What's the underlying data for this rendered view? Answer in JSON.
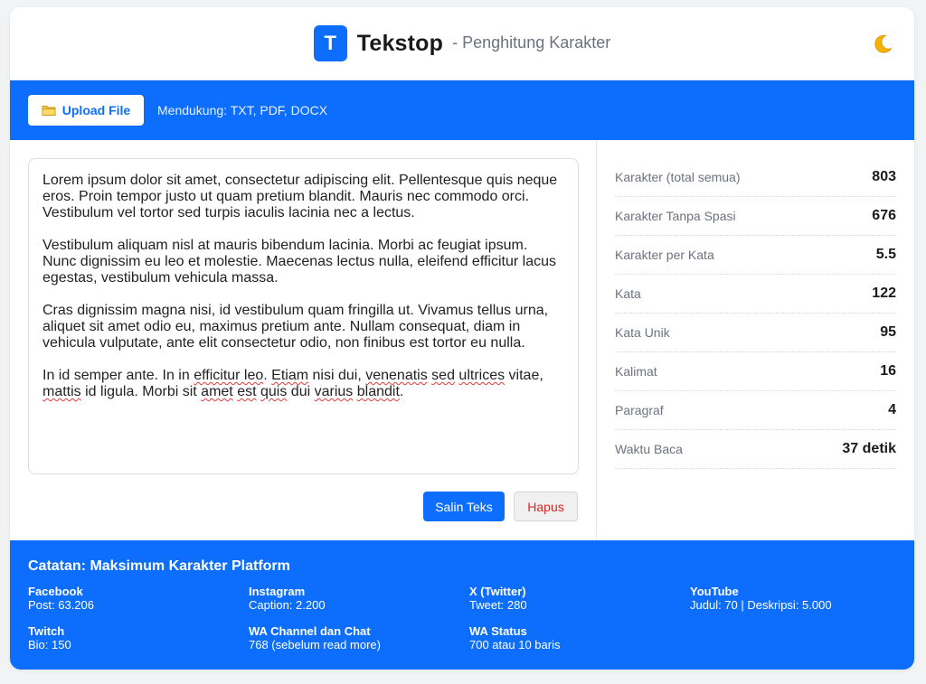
{
  "header": {
    "logo_letter": "T",
    "app_name": "Tekstop",
    "subtitle": "- Penghitung Karakter",
    "theme_icon": "moon-icon"
  },
  "toolbar": {
    "upload_label": "Upload File",
    "upload_icon": "folder-icon",
    "supported": "Mendukung: TXT, PDF, DOCX"
  },
  "editor": {
    "paragraphs": [
      "Lorem ipsum dolor sit amet, consectetur adipiscing elit. Pellentesque quis neque eros. Proin tempor justo ut quam pretium blandit. Mauris nec commodo orci. Vestibulum vel tortor sed turpis iaculis lacinia nec a lectus.",
      "Vestibulum aliquam nisl at mauris bibendum lacinia. Morbi ac feugiat ipsum. Nunc dignissim eu leo et molestie. Maecenas lectus nulla, eleifend efficitur lacus egestas, vestibulum vehicula massa.",
      "Cras dignissim magna nisi, id vestibulum quam fringilla ut. Vivamus tellus urna, aliquet sit amet odio eu, maximus pretium ante. Nullam consequat, diam in vehicula vulputate, ante elit consectetur odio, non finibus est tortor eu nulla."
    ],
    "last_paragraph": {
      "s1": "In id semper ante. In in ",
      "s2": "efficitur leo",
      "s3": ". ",
      "s4": "Etiam",
      "s5": " nisi dui, ",
      "s6": "venenatis",
      "s7": " ",
      "s8": "sed",
      "s9": " ",
      "s10": "ultrices",
      "s11": " vitae, ",
      "s12": "mattis",
      "s13": " id ligula. Morbi sit ",
      "s14": "amet",
      "s15": " ",
      "s16": "est",
      "s17": " ",
      "s18": "quis",
      "s19": " dui ",
      "s20": "varius",
      "s21": " ",
      "s22": "blandit",
      "s23": "."
    },
    "copy_label": "Salin Teks",
    "clear_label": "Hapus"
  },
  "stats": [
    {
      "label": "Karakter (total semua)",
      "value": "803"
    },
    {
      "label": "Karakter Tanpa Spasi",
      "value": "676"
    },
    {
      "label": "Karakter per Kata",
      "value": "5.5"
    },
    {
      "label": "Kata",
      "value": "122"
    },
    {
      "label": "Kata Unik",
      "value": "95"
    },
    {
      "label": "Kalimat",
      "value": "16"
    },
    {
      "label": "Paragraf",
      "value": "4"
    },
    {
      "label": "Waktu Baca",
      "value": "37 detik"
    }
  ],
  "footer": {
    "title": "Catatan: Maksimum Karakter Platform",
    "platforms": [
      {
        "name": "Facebook",
        "limit": "Post: 63.206"
      },
      {
        "name": "Instagram",
        "limit": "Caption: 2.200"
      },
      {
        "name": "X (Twitter)",
        "limit": "Tweet: 280"
      },
      {
        "name": "YouTube",
        "limit": "Judul: 70 | Deskripsi: 5.000"
      },
      {
        "name": "Twitch",
        "limit": "Bio: 150"
      },
      {
        "name": "WA Channel dan Chat",
        "limit": "768 (sebelum read more)"
      },
      {
        "name": "WA Status",
        "limit": "700 atau 10 baris"
      }
    ]
  },
  "colors": {
    "primary": "#0d6efd",
    "danger": "#dc2626"
  }
}
